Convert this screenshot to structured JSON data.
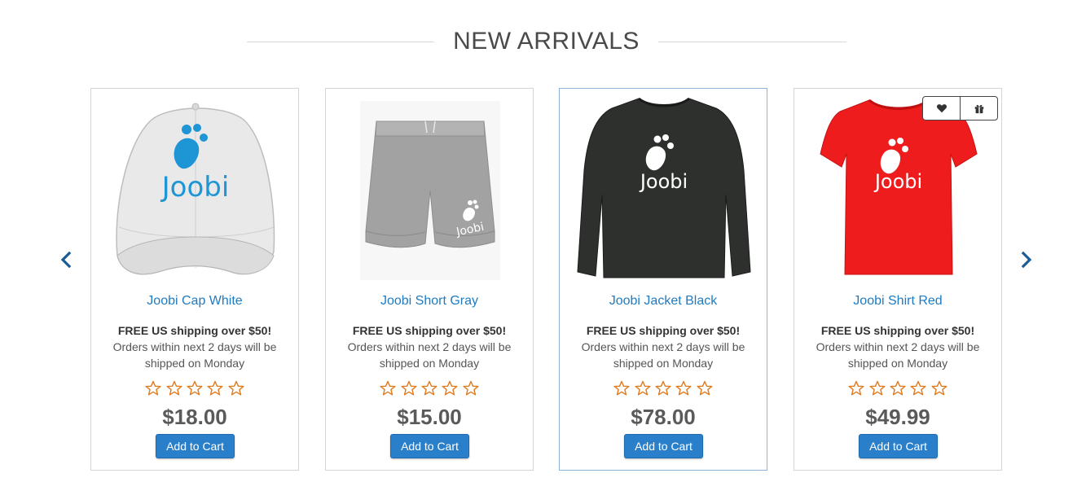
{
  "section": {
    "title": "NEW ARRIVALS"
  },
  "colors": {
    "link_blue": "#1f7bc1",
    "button_blue": "#2a7fcb",
    "star_orange": "#e07a1f",
    "price_gray": "#5a5a5a",
    "active_border": "#8fb2d6"
  },
  "carousel": {
    "prev_icon": "chevron-left-icon",
    "next_icon": "chevron-right-icon"
  },
  "products": [
    {
      "name": "Joobi Cap White",
      "image_icon": "cap-product-image",
      "shipping_title": "FREE US shipping over $50!",
      "shipping_note": "Orders within next 2 days will be shipped on Monday",
      "rating": 0,
      "rating_max": 5,
      "price": "$18.00",
      "add_to_cart": "Add to Cart"
    },
    {
      "name": "Joobi Short Gray",
      "image_icon": "shorts-product-image",
      "shipping_title": "FREE US shipping over $50!",
      "shipping_note": "Orders within next 2 days will be shipped on Monday",
      "rating": 0,
      "rating_max": 5,
      "price": "$15.00",
      "add_to_cart": "Add to Cart"
    },
    {
      "name": "Joobi Jacket Black",
      "image_icon": "long-sleeve-product-image",
      "shipping_title": "FREE US shipping over $50!",
      "shipping_note": "Orders within next 2 days will be shipped on Monday",
      "rating": 0,
      "rating_max": 5,
      "price": "$78.00",
      "add_to_cart": "Add to Cart"
    },
    {
      "name": "Joobi Shirt Red",
      "image_icon": "tshirt-product-image",
      "shipping_title": "FREE US shipping over $50!",
      "shipping_note": "Orders within next 2 days will be shipped on Monday",
      "rating": 0,
      "rating_max": 5,
      "price": "$49.99",
      "add_to_cart": "Add to Cart",
      "hover_actions": [
        "heart-icon",
        "gift-icon"
      ]
    }
  ]
}
